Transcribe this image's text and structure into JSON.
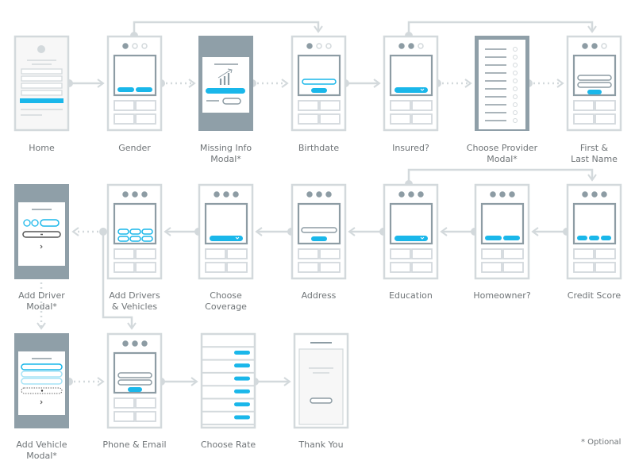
{
  "colors": {
    "accent": "#1ab7ea",
    "line": "#d3d9dc",
    "dark": "#8d9ca4",
    "modal_bg": "#8f9fa8"
  },
  "screens": [
    {
      "label": "Home",
      "type": "home"
    },
    {
      "label": "Gender",
      "type": "phone",
      "progress": 1,
      "content": "two-buttons"
    },
    {
      "label": "Missing Info\nModal*",
      "type": "info-modal"
    },
    {
      "label": "Birthdate",
      "type": "phone",
      "progress": 1,
      "content": "input-button"
    },
    {
      "label": "Insured?",
      "type": "phone",
      "progress": 2,
      "content": "select"
    },
    {
      "label": "Choose Provider\nModal*",
      "type": "list-modal"
    },
    {
      "label": "First &\nLast Name",
      "type": "phone",
      "progress": 2,
      "content": "two-inputs-button"
    },
    {
      "label": "Add Driver\nModal*",
      "type": "driver-modal"
    },
    {
      "label": "Add Drivers\n& Vehicles",
      "type": "phone",
      "progress": 3,
      "content": "six-options"
    },
    {
      "label": "Choose\nCoverage",
      "type": "phone",
      "progress": 3,
      "content": "select"
    },
    {
      "label": "Address",
      "type": "phone",
      "progress": 3,
      "content": "address"
    },
    {
      "label": "Education",
      "type": "phone",
      "progress": 3,
      "content": "select"
    },
    {
      "label": "Homeowner?",
      "type": "phone",
      "progress": 3,
      "content": "two-buttons"
    },
    {
      "label": "Credit Score",
      "type": "phone",
      "progress": 3,
      "content": "three-buttons"
    },
    {
      "label": "Add Vehicle\nModal*",
      "type": "vehicle-modal"
    },
    {
      "label": "Phone & Email",
      "type": "phone",
      "progress": 3,
      "content": "two-inputs-button"
    },
    {
      "label": "Choose Rate",
      "type": "rate"
    },
    {
      "label": "Thank You",
      "type": "thanks"
    }
  ],
  "footnote": "* Optional"
}
